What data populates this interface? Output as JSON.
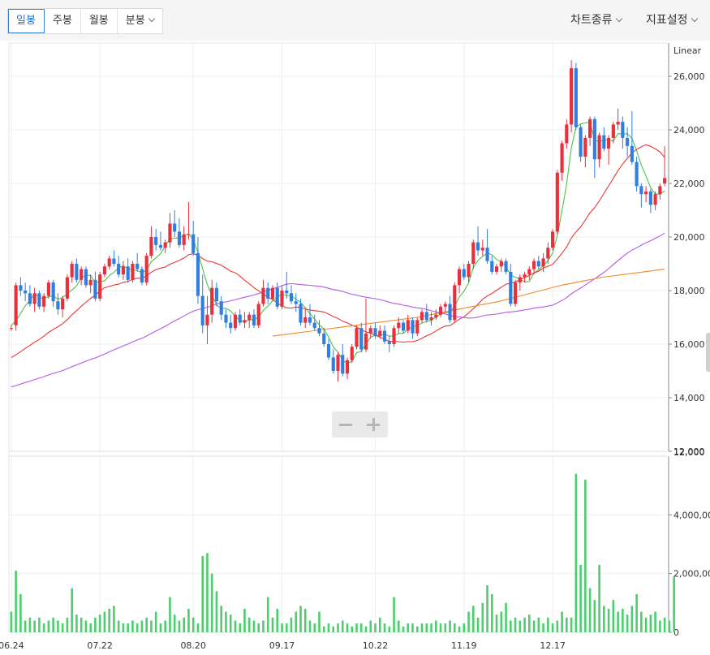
{
  "toolbar": {
    "tabs": [
      {
        "label": "일봉",
        "active": true
      },
      {
        "label": "주봉",
        "active": false
      },
      {
        "label": "월봉",
        "active": false
      },
      {
        "label": "분봉",
        "active": false
      }
    ],
    "chart_type_label": "차트종류",
    "indicator_label": "지표설정"
  },
  "colors": {
    "up": "#e8303d",
    "down": "#2f7ee0",
    "ma5": "#4cc34c",
    "ma20": "#e83838",
    "ma60": "#b45ae6",
    "ma120": "#f08a2a",
    "volume": "#4ccd6e",
    "grid": "#efefef",
    "axis": "#999999"
  },
  "chart_data": [
    {
      "type": "candlestick",
      "scale_label": "Linear",
      "ylim": [
        12000,
        27000
      ],
      "y_ticks": [
        "12,000",
        "14,000",
        "16,000",
        "18,000",
        "20,000",
        "22,000",
        "24,000",
        "26,000"
      ],
      "x_labels": [
        "06.24",
        "07.22",
        "08.20",
        "09.17",
        "10.22",
        "11.19",
        "12.17"
      ],
      "x_label_index": [
        0,
        19,
        39,
        58,
        78,
        97,
        116
      ],
      "moving_averages": [
        {
          "key": "ma5",
          "close_window": 5,
          "start_value": 16700
        },
        {
          "key": "ma20",
          "close_window": 20,
          "start_value": 15500
        },
        {
          "key": "ma60",
          "close_window": 60,
          "start_value": 14400
        },
        {
          "key": "ma120",
          "start_index": 56,
          "values": [
            16300,
            16400,
            16500,
            16600,
            16700,
            16800,
            16900,
            17000,
            17150,
            17300,
            17450,
            17600,
            17800,
            18000,
            18200,
            18350,
            18500,
            18600,
            18700,
            18800
          ]
        }
      ],
      "candles": [
        [
          16600,
          16700,
          16500,
          16600
        ],
        [
          16700,
          18300,
          16500,
          18200
        ],
        [
          18200,
          18500,
          17800,
          18000
        ],
        [
          18000,
          18300,
          17600,
          17900
        ],
        [
          17900,
          18200,
          17400,
          17500
        ],
        [
          17500,
          18100,
          17200,
          17900
        ],
        [
          17900,
          18000,
          17300,
          17400
        ],
        [
          17400,
          17900,
          17200,
          17800
        ],
        [
          17800,
          18400,
          17700,
          18300
        ],
        [
          18300,
          18400,
          17400,
          17600
        ],
        [
          17600,
          17900,
          17100,
          17300
        ],
        [
          17300,
          17800,
          17000,
          17700
        ],
        [
          17700,
          18600,
          17600,
          18500
        ],
        [
          18500,
          19100,
          18300,
          19000
        ],
        [
          19000,
          19200,
          18300,
          18400
        ],
        [
          18400,
          18900,
          18200,
          18800
        ],
        [
          18800,
          18900,
          18100,
          18200
        ],
        [
          18200,
          18600,
          17900,
          18400
        ],
        [
          18400,
          18700,
          17600,
          17700
        ],
        [
          17700,
          18700,
          17600,
          18600
        ],
        [
          18600,
          19000,
          18500,
          18900
        ],
        [
          18900,
          19300,
          18800,
          19200
        ],
        [
          19200,
          19500,
          18900,
          19000
        ],
        [
          19000,
          19300,
          18500,
          18600
        ],
        [
          18600,
          19100,
          18400,
          18900
        ],
        [
          18900,
          19200,
          18300,
          18400
        ],
        [
          18400,
          19100,
          18300,
          19000
        ],
        [
          19000,
          19400,
          18700,
          18800
        ],
        [
          18800,
          18900,
          18200,
          18300
        ],
        [
          18300,
          19400,
          18200,
          19300
        ],
        [
          19300,
          20400,
          19200,
          20000
        ],
        [
          20000,
          20300,
          19500,
          19700
        ],
        [
          19700,
          20200,
          19500,
          19600
        ],
        [
          19600,
          19900,
          19400,
          19800
        ],
        [
          19800,
          20900,
          19600,
          20500
        ],
        [
          20500,
          21000,
          20000,
          20200
        ],
        [
          20200,
          20700,
          19600,
          19700
        ],
        [
          19700,
          20400,
          19500,
          20100
        ],
        [
          20100,
          21300,
          19900,
          20100
        ],
        [
          20100,
          20600,
          19300,
          19400
        ],
        [
          19400,
          20000,
          17500,
          17800
        ],
        [
          17800,
          18600,
          16400,
          16700
        ],
        [
          16700,
          17800,
          16000,
          17100
        ],
        [
          17100,
          18400,
          16800,
          18100
        ],
        [
          18100,
          18300,
          17400,
          17600
        ],
        [
          17600,
          17800,
          16900,
          17100
        ],
        [
          17100,
          17300,
          16600,
          16800
        ],
        [
          16800,
          17100,
          16400,
          16600
        ],
        [
          16600,
          17200,
          16500,
          17100
        ],
        [
          17100,
          17300,
          16700,
          16800
        ],
        [
          16800,
          17200,
          16600,
          16900
        ],
        [
          16900,
          17200,
          16600,
          17100
        ],
        [
          17100,
          17300,
          16600,
          16700
        ],
        [
          16700,
          17600,
          16600,
          17500
        ],
        [
          17500,
          18400,
          17400,
          18100
        ],
        [
          18100,
          18300,
          17500,
          17700
        ],
        [
          17700,
          18200,
          17600,
          18100
        ],
        [
          18100,
          18300,
          17300,
          17400
        ],
        [
          17400,
          18200,
          17300,
          18000
        ],
        [
          18000,
          18700,
          17700,
          17900
        ],
        [
          17900,
          18200,
          17500,
          17600
        ],
        [
          17600,
          17900,
          17200,
          17500
        ],
        [
          17500,
          17700,
          16700,
          16800
        ],
        [
          16800,
          17300,
          16600,
          17000
        ],
        [
          17000,
          17500,
          16700,
          16800
        ],
        [
          16800,
          17100,
          16500,
          16600
        ],
        [
          16600,
          16900,
          16300,
          16400
        ],
        [
          16400,
          16600,
          15900,
          16000
        ],
        [
          16000,
          16200,
          15400,
          15500
        ],
        [
          15500,
          15800,
          14900,
          15000
        ],
        [
          15000,
          15700,
          14600,
          15600
        ],
        [
          15600,
          16000,
          14800,
          14900
        ],
        [
          14900,
          15500,
          14700,
          15400
        ],
        [
          15400,
          16000,
          15300,
          15900
        ],
        [
          15900,
          16700,
          15800,
          16600
        ],
        [
          16600,
          16800,
          15700,
          15800
        ],
        [
          15800,
          17700,
          15700,
          16400
        ],
        [
          16400,
          16700,
          16200,
          16600
        ],
        [
          16600,
          16800,
          16200,
          16300
        ],
        [
          16300,
          16700,
          16200,
          16500
        ],
        [
          16500,
          16700,
          16000,
          16100
        ],
        [
          16100,
          16300,
          15700,
          16000
        ],
        [
          16000,
          16700,
          15900,
          16600
        ],
        [
          16600,
          17000,
          16400,
          16800
        ],
        [
          16800,
          16900,
          16400,
          16500
        ],
        [
          16500,
          17100,
          16400,
          16900
        ],
        [
          16900,
          17000,
          16200,
          16400
        ],
        [
          16400,
          17000,
          16300,
          16900
        ],
        [
          16900,
          17300,
          16800,
          17200
        ],
        [
          17200,
          17500,
          16800,
          16900
        ],
        [
          16900,
          17200,
          16700,
          17000
        ],
        [
          17000,
          17300,
          16900,
          17100
        ],
        [
          17100,
          17500,
          17000,
          17400
        ],
        [
          17400,
          17600,
          17200,
          17500
        ],
        [
          17500,
          17800,
          16800,
          16900
        ],
        [
          16900,
          18300,
          16800,
          18200
        ],
        [
          18200,
          18900,
          17900,
          18800
        ],
        [
          18800,
          19000,
          18400,
          18500
        ],
        [
          18500,
          19100,
          18300,
          19000
        ],
        [
          19000,
          19900,
          18800,
          19800
        ],
        [
          19800,
          20400,
          19300,
          19500
        ],
        [
          19500,
          19900,
          19300,
          19600
        ],
        [
          19600,
          20300,
          19000,
          19100
        ],
        [
          19100,
          19300,
          18600,
          18700
        ],
        [
          18700,
          19000,
          18600,
          18900
        ],
        [
          18900,
          19200,
          18700,
          19100
        ],
        [
          19100,
          19200,
          18600,
          18700
        ],
        [
          18700,
          19000,
          17400,
          17500
        ],
        [
          17500,
          18400,
          17400,
          18300
        ],
        [
          18300,
          18600,
          18000,
          18500
        ],
        [
          18500,
          18700,
          18300,
          18600
        ],
        [
          18600,
          18900,
          18400,
          18800
        ],
        [
          18800,
          19200,
          18600,
          19100
        ],
        [
          19100,
          19300,
          18800,
          18900
        ],
        [
          18900,
          19400,
          18700,
          19200
        ],
        [
          19200,
          19800,
          19000,
          19600
        ],
        [
          19600,
          20300,
          19500,
          20200
        ],
        [
          20200,
          22500,
          20100,
          22400
        ],
        [
          22400,
          23600,
          22100,
          23500
        ],
        [
          23500,
          24400,
          23300,
          24200
        ],
        [
          24200,
          26600,
          23900,
          26300
        ],
        [
          26300,
          26500,
          24000,
          24100
        ],
        [
          24100,
          24200,
          22800,
          23000
        ],
        [
          23000,
          23800,
          22600,
          23700
        ],
        [
          23700,
          24500,
          23400,
          24400
        ],
        [
          24400,
          24500,
          22200,
          22900
        ],
        [
          22900,
          23900,
          22600,
          23800
        ],
        [
          23800,
          24100,
          23200,
          23300
        ],
        [
          23300,
          23800,
          22700,
          23700
        ],
        [
          23700,
          24300,
          23500,
          24200
        ],
        [
          24200,
          24800,
          24000,
          24300
        ],
        [
          24300,
          24500,
          23300,
          23700
        ],
        [
          23700,
          24100,
          23000,
          23400
        ],
        [
          23400,
          24700,
          22700,
          22800
        ],
        [
          22800,
          23000,
          21700,
          21900
        ],
        [
          21900,
          22000,
          21100,
          21600
        ],
        [
          21600,
          21900,
          21300,
          21700
        ],
        [
          21700,
          21800,
          20900,
          21200
        ],
        [
          21200,
          21700,
          21000,
          21600
        ],
        [
          21600,
          22000,
          21400,
          21900
        ],
        [
          22000,
          23400,
          21900,
          22200
        ]
      ]
    },
    {
      "type": "bar",
      "series_key": "volume",
      "ylim": [
        0,
        6000000
      ],
      "y_ticks": [
        "0",
        "2,000,000",
        "4,000,000"
      ],
      "values": [
        700000,
        2100000,
        1300000,
        400000,
        500000,
        400000,
        500000,
        300000,
        400000,
        500000,
        400000,
        300000,
        500000,
        1500000,
        600000,
        500000,
        400000,
        300000,
        500000,
        600000,
        700000,
        800000,
        900000,
        400000,
        300000,
        300000,
        400000,
        300000,
        400000,
        500000,
        400000,
        700000,
        300000,
        400000,
        1200000,
        600000,
        400000,
        500000,
        800000,
        500000,
        300000,
        2600000,
        2700000,
        2000000,
        1400000,
        900000,
        700000,
        600000,
        400000,
        300000,
        800000,
        500000,
        400000,
        300000,
        400000,
        1200000,
        500000,
        800000,
        300000,
        300000,
        500000,
        700000,
        900000,
        800000,
        400000,
        300000,
        700000,
        200000,
        300000,
        200000,
        300000,
        400000,
        300000,
        200000,
        300000,
        300000,
        200000,
        400000,
        300000,
        500000,
        300000,
        200000,
        1200000,
        400000,
        200000,
        300000,
        300000,
        200000,
        300000,
        300000,
        300000,
        400000,
        300000,
        300000,
        400000,
        300000,
        200000,
        300000,
        700000,
        900000,
        500000,
        1000000,
        1600000,
        1300000,
        600000,
        700000,
        1000000,
        400000,
        500000,
        400000,
        500000,
        600000,
        400000,
        500000,
        300000,
        500000,
        300000,
        400000,
        700000,
        500000,
        500000,
        5400000,
        2300000,
        5200000,
        1500000,
        1100000,
        2300000,
        900000,
        800000,
        1100000,
        700000,
        800000,
        600000,
        900000,
        1300000,
        700000,
        500000,
        600000,
        700000,
        400000,
        500000,
        400000,
        1900000
      ]
    }
  ]
}
